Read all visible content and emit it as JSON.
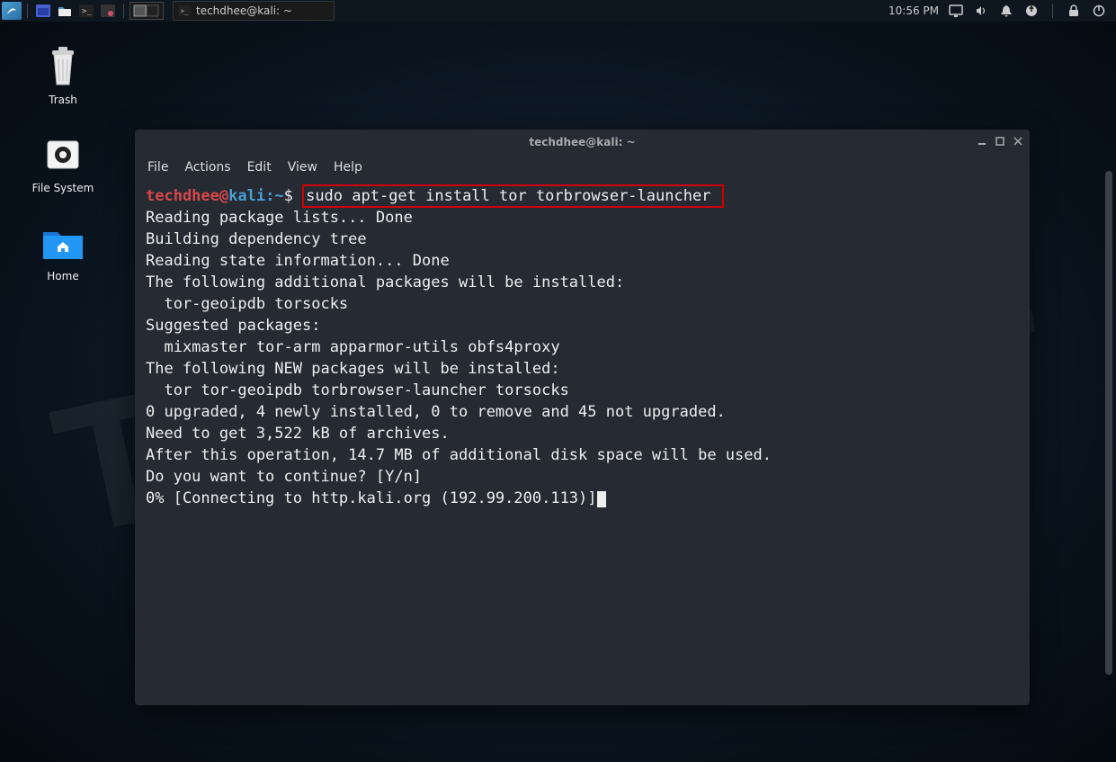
{
  "taskbar": {
    "active_app_title": "techdhee@kali: ~",
    "clock": "10:56 PM"
  },
  "desktop": {
    "icons": [
      {
        "label": "Trash"
      },
      {
        "label": "File System"
      },
      {
        "label": "Home"
      }
    ]
  },
  "terminal": {
    "title": "techdhee@kali: ~",
    "menus": [
      "File",
      "Actions",
      "Edit",
      "View",
      "Help"
    ],
    "prompt": {
      "user": "techdhee",
      "at": "@",
      "host": "kali",
      "sep": ":",
      "path": "~",
      "symbol": "$ "
    },
    "command": "sudo apt-get install tor torbrowser-launcher",
    "output_lines": [
      "Reading package lists... Done",
      "Building dependency tree",
      "Reading state information... Done",
      "The following additional packages will be installed:",
      "  tor-geoipdb torsocks",
      "Suggested packages:",
      "  mixmaster tor-arm apparmor-utils obfs4proxy",
      "The following NEW packages will be installed:",
      "  tor tor-geoipdb torbrowser-launcher torsocks",
      "0 upgraded, 4 newly installed, 0 to remove and 45 not upgraded.",
      "Need to get 3,522 kB of archives.",
      "After this operation, 14.7 MB of additional disk space will be used.",
      "Do you want to continue? [Y/n]",
      "0% [Connecting to http.kali.org (192.99.200.113)]"
    ]
  },
  "watermark_text": "TECHDHEE"
}
